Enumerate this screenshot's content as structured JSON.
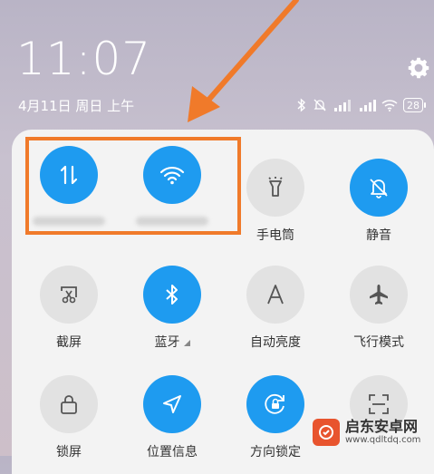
{
  "status": {
    "time": "11:07",
    "date": "4月11日 周日 上午",
    "battery": "28"
  },
  "tiles": [
    {
      "id": "mobile-data",
      "label": "",
      "state": "on",
      "icon": "data-transfer-icon"
    },
    {
      "id": "wifi",
      "label": "",
      "state": "on",
      "icon": "wifi-icon"
    },
    {
      "id": "flashlight",
      "label": "手电筒",
      "state": "off",
      "icon": "flashlight-icon"
    },
    {
      "id": "mute",
      "label": "静音",
      "state": "on",
      "icon": "bell-off-icon"
    },
    {
      "id": "screenshot",
      "label": "截屏",
      "state": "off",
      "icon": "screenshot-icon"
    },
    {
      "id": "bluetooth",
      "label": "蓝牙",
      "state": "on",
      "icon": "bluetooth-icon"
    },
    {
      "id": "auto-brightness",
      "label": "自动亮度",
      "state": "off",
      "icon": "letter-a-icon"
    },
    {
      "id": "airplane",
      "label": "飞行模式",
      "state": "off",
      "icon": "airplane-icon"
    },
    {
      "id": "lock-screen",
      "label": "锁屏",
      "state": "off",
      "icon": "lock-icon"
    },
    {
      "id": "location",
      "label": "位置信息",
      "state": "on",
      "icon": "location-arrow-icon"
    },
    {
      "id": "rotation-lock",
      "label": "方向锁定",
      "state": "on",
      "icon": "rotation-lock-icon"
    },
    {
      "id": "scanner",
      "label": "",
      "state": "off",
      "icon": "scan-icon"
    }
  ],
  "watermark": {
    "main": "启东安卓网",
    "sub": "www.qdltdq.com"
  },
  "colors": {
    "accent": "#1e9bf0",
    "highlight": "#f07a2a"
  }
}
